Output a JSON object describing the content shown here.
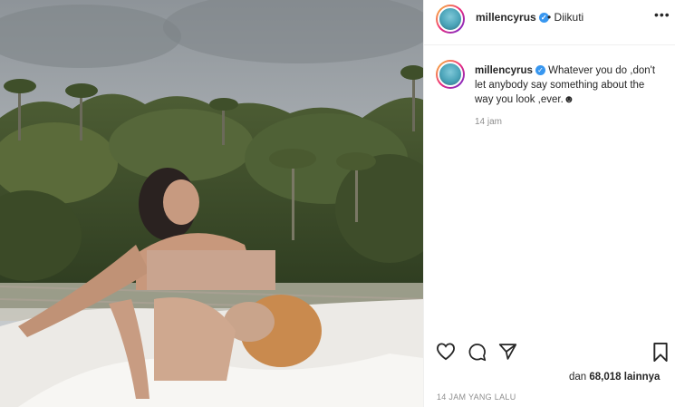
{
  "post": {
    "username": "millencyrus",
    "verified_badge": "✓",
    "follow_status": "• Diikuti",
    "more_icon": "•••",
    "caption_text": "Whatever you do ,don't let anybody say something about the way you look ,ever.",
    "caption_emoji": "☻",
    "relative_time": "14 jam",
    "likes_prefix": "dan",
    "likes_count": "68,018",
    "likes_suffix": "lainnya",
    "time_ago": "14 JAM YANG LALU"
  },
  "icons": [
    "heart-icon",
    "comment-icon",
    "share-icon",
    "bookmark-icon",
    "more-options-icon",
    "verified-icon"
  ],
  "colors": {
    "verified_blue": "#3897f0",
    "text": "#262626",
    "muted": "#8e8e8e",
    "blur_block": "#c9a48f"
  }
}
